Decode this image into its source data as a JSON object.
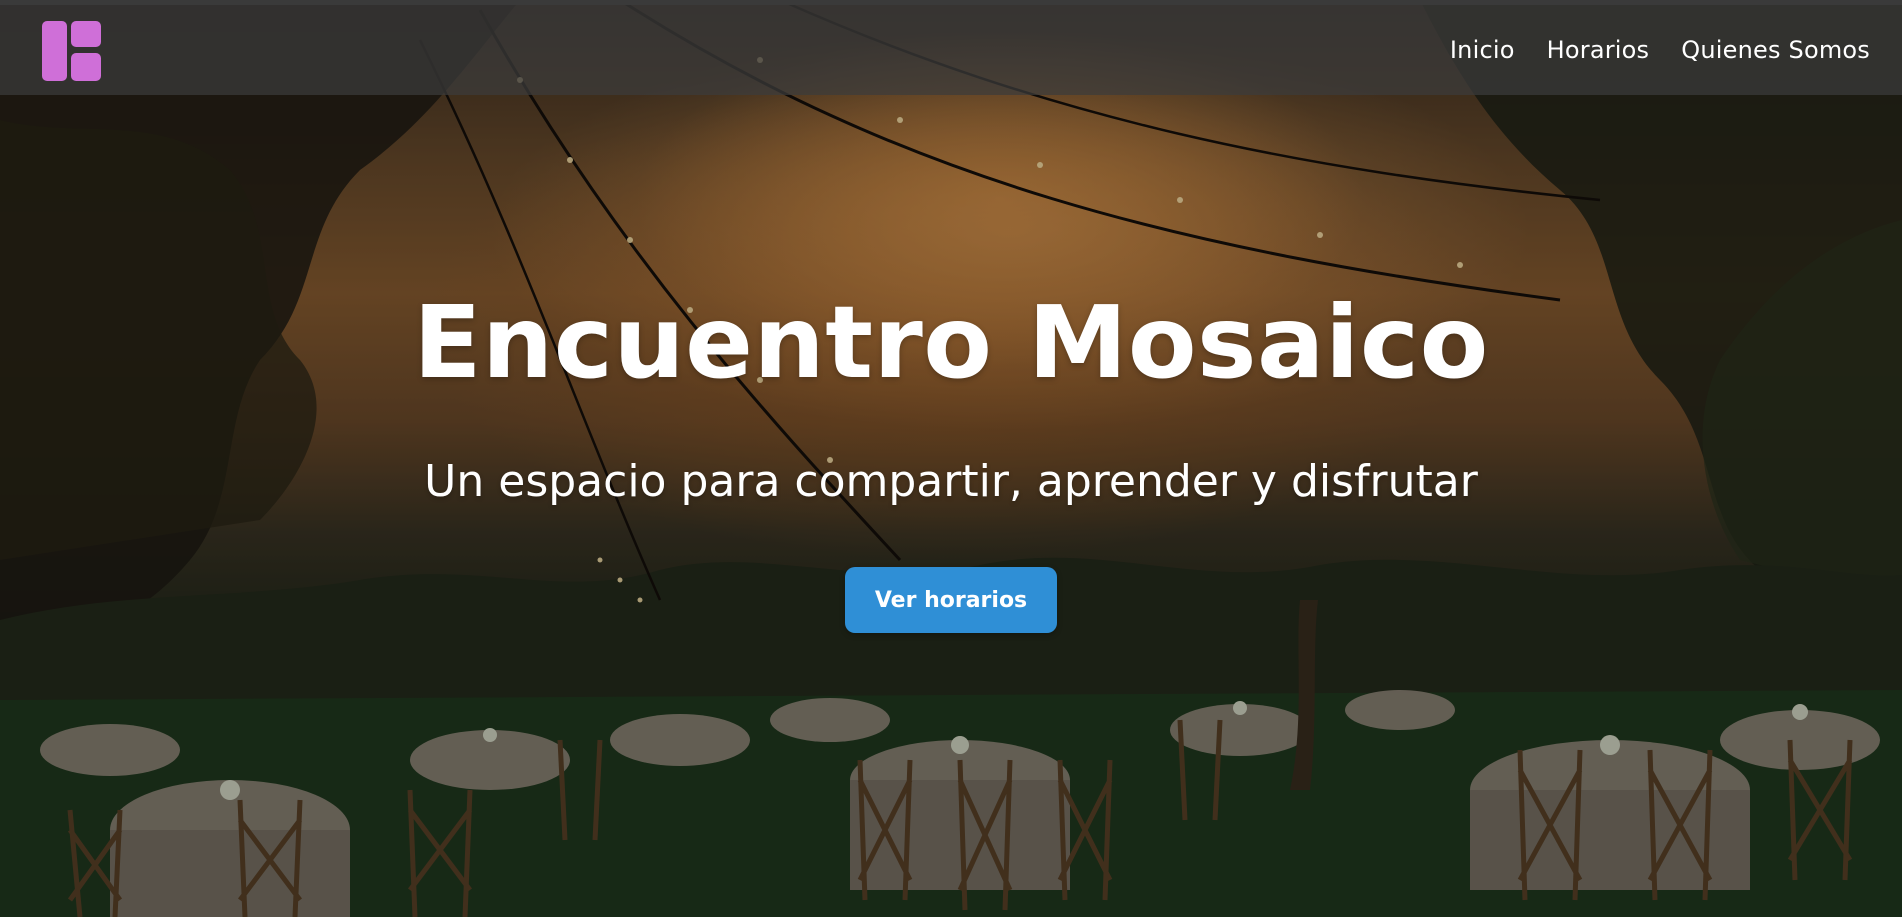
{
  "header": {
    "logo_icon": "mosaic-logo-icon",
    "logo_color": "#cf6fd8",
    "nav": [
      {
        "label": "Inicio"
      },
      {
        "label": "Horarios"
      },
      {
        "label": "Quienes Somos"
      }
    ]
  },
  "hero": {
    "background_image": "outdoor-banquet-photo",
    "title": "Encuentro Mosaico",
    "subtitle": "Un espacio para compartir, aprender y disfrutar",
    "cta_label": "Ver horarios",
    "cta_color": "#2f8fd6"
  }
}
